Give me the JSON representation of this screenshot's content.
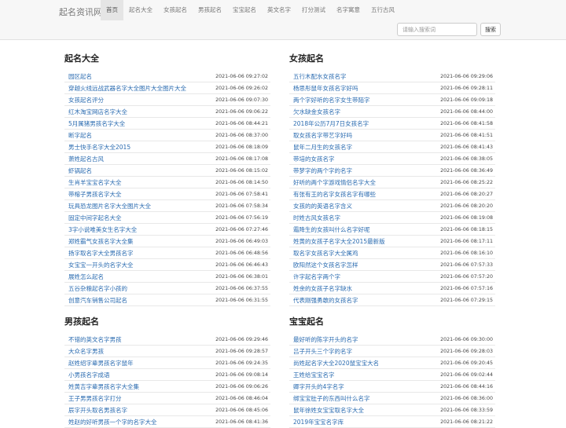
{
  "brand": "起名资讯网",
  "nav": [
    "首页",
    "起名大全",
    "女孩起名",
    "男孩起名",
    "宝宝起名",
    "英文名字",
    "打分测试",
    "名字寓意",
    "五行古风"
  ],
  "search": {
    "placeholder": "请输入搜索词",
    "button": "搜索"
  },
  "sections": [
    {
      "title": "起名大全",
      "items": [
        {
          "t": "园区起名",
          "d": "2021-06-06 09:27:02"
        },
        {
          "t": "穿越火线远战武器名字大全图片大全图片大全",
          "d": "2021-06-06 09:26:02"
        },
        {
          "t": "女孩起名评分",
          "d": "2021-06-06 09:07:30"
        },
        {
          "t": "红木淘宝网店名字大全",
          "d": "2021-06-06 09:06:22"
        },
        {
          "t": "5月属猪男孩名字大全",
          "d": "2021-06-06 08:44:21"
        },
        {
          "t": "断字起名",
          "d": "2021-06-06 08:37:00"
        },
        {
          "t": "男士快手名字大全2015",
          "d": "2021-06-06 08:18:09"
        },
        {
          "t": "萧姓起名古风",
          "d": "2021-06-06 08:17:08"
        },
        {
          "t": "虾锅起名",
          "d": "2021-06-06 08:15:02"
        },
        {
          "t": "生肖羊宝宝名字大全",
          "d": "2021-06-06 08:14:50"
        },
        {
          "t": "带榕子男孩名字大全",
          "d": "2021-06-06 07:58:41"
        },
        {
          "t": "玩具恐龙图片名字大全图片大全",
          "d": "2021-06-06 07:58:34"
        },
        {
          "t": "固定中间字起名大全",
          "d": "2021-06-06 07:56:19"
        },
        {
          "t": "3字小说唯美女生名字大全",
          "d": "2021-06-06 07:27:46"
        },
        {
          "t": "郑姓霸气女孩名字大全集",
          "d": "2021-06-06 06:49:03"
        },
        {
          "t": "扬字取名字大全男孩名字",
          "d": "2021-06-06 06:48:56"
        },
        {
          "t": "女宝宝一开头的名字大全",
          "d": "2021-06-06 06:46:43"
        },
        {
          "t": "展姓怎么起名",
          "d": "2021-06-06 06:38:01"
        },
        {
          "t": "五谷杂粮起名字小孩的",
          "d": "2021-06-06 06:37:55"
        },
        {
          "t": "创意汽车销售公司起名",
          "d": "2021-06-06 06:31:55"
        }
      ]
    },
    {
      "title": "女孩起名",
      "items": [
        {
          "t": "五行木配水女孩名字",
          "d": "2021-06-06 09:29:06"
        },
        {
          "t": "杨思彤鼠年女孩名字好吗",
          "d": "2021-06-06 09:28:11"
        },
        {
          "t": "两个字好听的名字女生带陌字",
          "d": "2021-06-06 09:09:18"
        },
        {
          "t": "欠水缺金女孩名字",
          "d": "2021-06-06 08:44:00"
        },
        {
          "t": "2018年公历7月7日女孩名字",
          "d": "2021-06-06 08:41:58"
        },
        {
          "t": "取女孩名字带艺字好吗",
          "d": "2021-06-06 08:41:51"
        },
        {
          "t": "鼠年二月生的女孩名字",
          "d": "2021-06-06 08:41:43"
        },
        {
          "t": "带培的女孩名字",
          "d": "2021-06-06 08:38:05"
        },
        {
          "t": "带梦字的两个字的名字",
          "d": "2021-06-06 08:36:49"
        },
        {
          "t": "好听的两个字游戏情侣名字大全",
          "d": "2021-06-06 08:25:22"
        },
        {
          "t": "有张有王的名字女孩名字有哪些",
          "d": "2021-06-06 08:20:27"
        },
        {
          "t": "女孩的的英语名字含义",
          "d": "2021-06-06 08:20:20"
        },
        {
          "t": "时姓古风女孩名字",
          "d": "2021-06-06 08:19:08"
        },
        {
          "t": "霜降生的女孩叫什么名字好呢",
          "d": "2021-06-06 08:18:15"
        },
        {
          "t": "姓黄的女孩子名字大全2015最新版",
          "d": "2021-06-06 08:17:11"
        },
        {
          "t": "取名字女孩名字大全属鸡",
          "d": "2021-06-06 08:16:10"
        },
        {
          "t": "欧阳然这个女孩名字怎样",
          "d": "2021-06-06 07:57:33"
        },
        {
          "t": "许字起名字两个字",
          "d": "2021-06-06 07:57:20"
        },
        {
          "t": "姓余的女孩子名字缺水",
          "d": "2021-06-06 07:57:16"
        },
        {
          "t": "代表刚强勇敢的女孩名字",
          "d": "2021-06-06 07:29:15"
        }
      ]
    },
    {
      "title": "男孩起名",
      "items": [
        {
          "t": "不错的英文名字男孩",
          "d": "2021-06-06 09:29:46"
        },
        {
          "t": "大众名字男孩",
          "d": "2021-06-06 09:28:57"
        },
        {
          "t": "赵姓绍字辈男孩名字鼠年",
          "d": "2021-06-06 09:24:35"
        },
        {
          "t": "小男孩名字成语",
          "d": "2021-06-06 09:08:14"
        },
        {
          "t": "姓黄吉字辈男孩名字大全集",
          "d": "2021-06-06 09:06:26"
        },
        {
          "t": "王子男男孩名字打分",
          "d": "2021-06-06 08:46:04"
        },
        {
          "t": "辰字开头取名男孩名字",
          "d": "2021-06-06 08:45:06"
        },
        {
          "t": "姓赵的好听男孩一个字的名字大全",
          "d": "2021-06-06 08:41:36"
        }
      ]
    },
    {
      "title": "宝宝起名",
      "items": [
        {
          "t": "最好听的陈字开头的名字",
          "d": "2021-06-06 09:30:00"
        },
        {
          "t": "吕子开头三个字的名字",
          "d": "2021-06-06 09:28:03"
        },
        {
          "t": "尚姓起名字大全2020鼠宝宝大名",
          "d": "2021-06-06 09:20:45"
        },
        {
          "t": "王姓给宝宝名字",
          "d": "2021-06-06 09:02:44"
        },
        {
          "t": "卿字开头的4字名字",
          "d": "2021-06-06 08:44:16"
        },
        {
          "t": "绑宝宝肚子的东西叫什么名字",
          "d": "2021-06-06 08:36:00"
        },
        {
          "t": "鼠年徐姓女宝宝取名字大全",
          "d": "2021-06-06 08:33:59"
        },
        {
          "t": "2019年宝宝名字库",
          "d": "2021-06-06 08:21:22"
        }
      ]
    }
  ]
}
